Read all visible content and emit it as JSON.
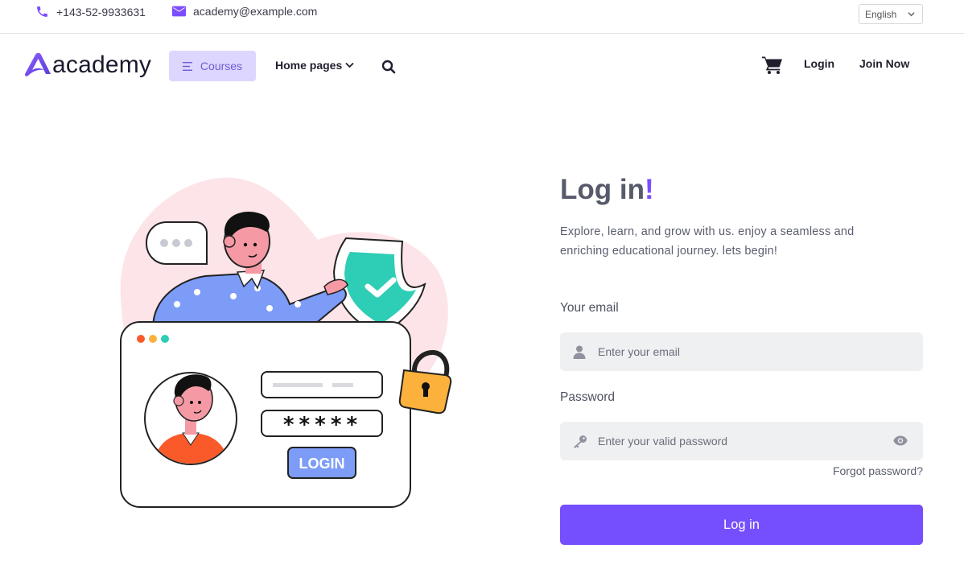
{
  "topbar": {
    "phone": "+143-52-9933631",
    "email": "academy@example.com",
    "language": "English",
    "phone_icon": "phone-icon",
    "mail_icon": "mail-icon"
  },
  "nav": {
    "logo_text": "academy",
    "courses_label": "Courses",
    "home_pages_label": "Home pages",
    "login_label": "Login",
    "join_label": "Join Now",
    "search_icon": "search-icon",
    "cart_icon": "cart-icon"
  },
  "illustration": {
    "login_button_text": "LOGIN",
    "password_mask": "*****"
  },
  "form": {
    "title": "Log in",
    "title_accent": "!",
    "description": "Explore, learn, and grow with us. enjoy a seamless and enriching educational journey. lets begin!",
    "email_label": "Your email",
    "email_placeholder": "Enter your email",
    "password_label": "Password",
    "password_placeholder": "Enter your valid password",
    "forgot_label": "Forgot password?",
    "submit_label": "Log in"
  },
  "colors": {
    "accent": "#754ffe",
    "courses_bg": "#ddd6fe",
    "field_bg": "#eef0f2",
    "shield_green": "#2ecdb5",
    "lock_yellow": "#fbb13c",
    "blob_pink": "#fde4e8"
  }
}
